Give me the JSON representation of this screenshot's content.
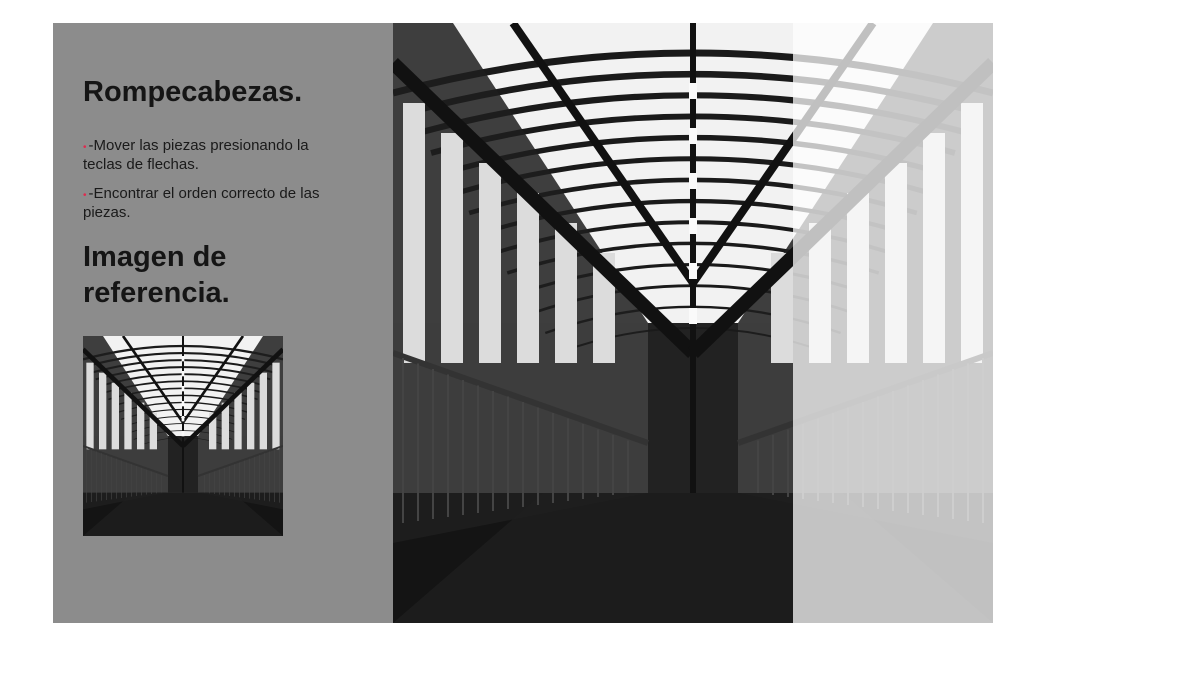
{
  "sidebar": {
    "title": "Rompecabezas.",
    "instructions": [
      {
        "bullet": "•",
        "text": "-Mover las piezas presionando la teclas de flechas."
      },
      {
        "bullet": "•",
        "text": "-Encontrar el orden correcto de las piezas."
      }
    ],
    "reference_title": "Imagen de referencia."
  },
  "board": {
    "rows": 3,
    "cols": 3,
    "tiles": [
      {
        "piece": 0,
        "empty": false
      },
      {
        "piece": 1,
        "empty": false
      },
      {
        "piece": 2,
        "empty": true
      },
      {
        "piece": 3,
        "empty": false
      },
      {
        "piece": 4,
        "empty": false
      },
      {
        "piece": 5,
        "empty": true
      },
      {
        "piece": 6,
        "empty": false
      },
      {
        "piece": 7,
        "empty": false
      },
      {
        "piece": 8,
        "empty": true
      }
    ]
  },
  "colors": {
    "sidebar_bg": "#8c8c8c",
    "bullet": "#e02a4f",
    "text": "#151515"
  }
}
